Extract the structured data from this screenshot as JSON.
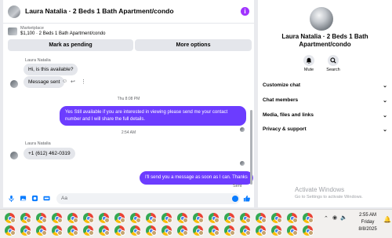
{
  "conversation": {
    "title": "Laura Natalia · 2 Beds 1 Bath Apartment/condo",
    "marketplace_label": "Marketplace",
    "listing": "$1,100 · 2 Beds 1 Bath Apartment/condo",
    "buttons": {
      "pending": "Mark as pending",
      "more": "More options"
    }
  },
  "messages": {
    "sender_1": "Laura Natalia",
    "msg_1": "Hi, is this available?",
    "msg_2": "Message sent",
    "timestamp_1": "Thu 8:08 PM",
    "msg_3": "Yes Still available if you are interested in viewing please send me your contact number and I will share the full details.",
    "timestamp_2": "2:54 AM",
    "sender_2": "Laura Natalia",
    "msg_4": "+1 (612) 462-0319",
    "msg_5": "I'll send you a message as soon as I can. Thanks",
    "status": "Sent"
  },
  "composer": {
    "placeholder": "Aa"
  },
  "info_panel": {
    "name": "Laura Natalia · 2 Beds 1 Bath Apartment/condo",
    "mute_label": "Mute",
    "search_label": "Search",
    "sections": [
      "Customize chat",
      "Chat members",
      "Media, files and links",
      "Privacy & support"
    ]
  },
  "watermark": {
    "title": "Activate Windows",
    "subtitle": "Go to Settings to activate Windows."
  },
  "taskbar": {
    "time": "2:55 AM",
    "day": "Friday",
    "date": "8/8/2025"
  },
  "icons": [
    "info-icon",
    "more-vert-icon",
    "reply-icon",
    "reaction-icon",
    "mic-icon",
    "image-icon",
    "sticker-icon",
    "gif-icon",
    "emoji-icon",
    "like-icon",
    "bell-icon",
    "search-icon",
    "chevron-down-icon",
    "chrome-icon"
  ],
  "colors": {
    "outgoing_bubble": "#6c3cff",
    "incoming_bubble": "#e4e6eb",
    "accent": "#0a7cff"
  }
}
